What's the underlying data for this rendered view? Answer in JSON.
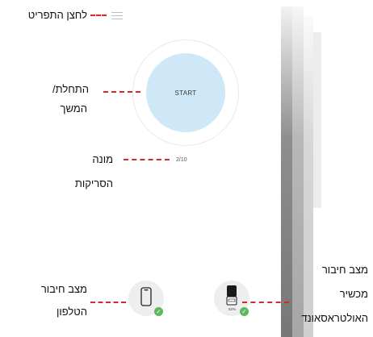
{
  "app": {
    "start_label": "START",
    "series_counter": "2/10",
    "ultrasound_battery": "82%"
  },
  "annotations": {
    "menu": "לחצן התפריט",
    "start_line1": "התחלת/",
    "start_line2": "המשך",
    "counter_line1": "מונה",
    "counter_line2": "הסריקות",
    "phone_line1": "מצב חיבור",
    "phone_line2": "הטלפון",
    "ultra_line1": "מצב חיבור",
    "ultra_line2": "מכשיר",
    "ultra_line3": "האולטראסאונד"
  },
  "colors": {
    "start_circle": "#cfe8f7",
    "connected_check": "#5cb85c",
    "annotation_line": "#d62828"
  },
  "icons": [
    "menu-icon",
    "phone-icon",
    "ultrasound-device-icon",
    "check-icon"
  ]
}
